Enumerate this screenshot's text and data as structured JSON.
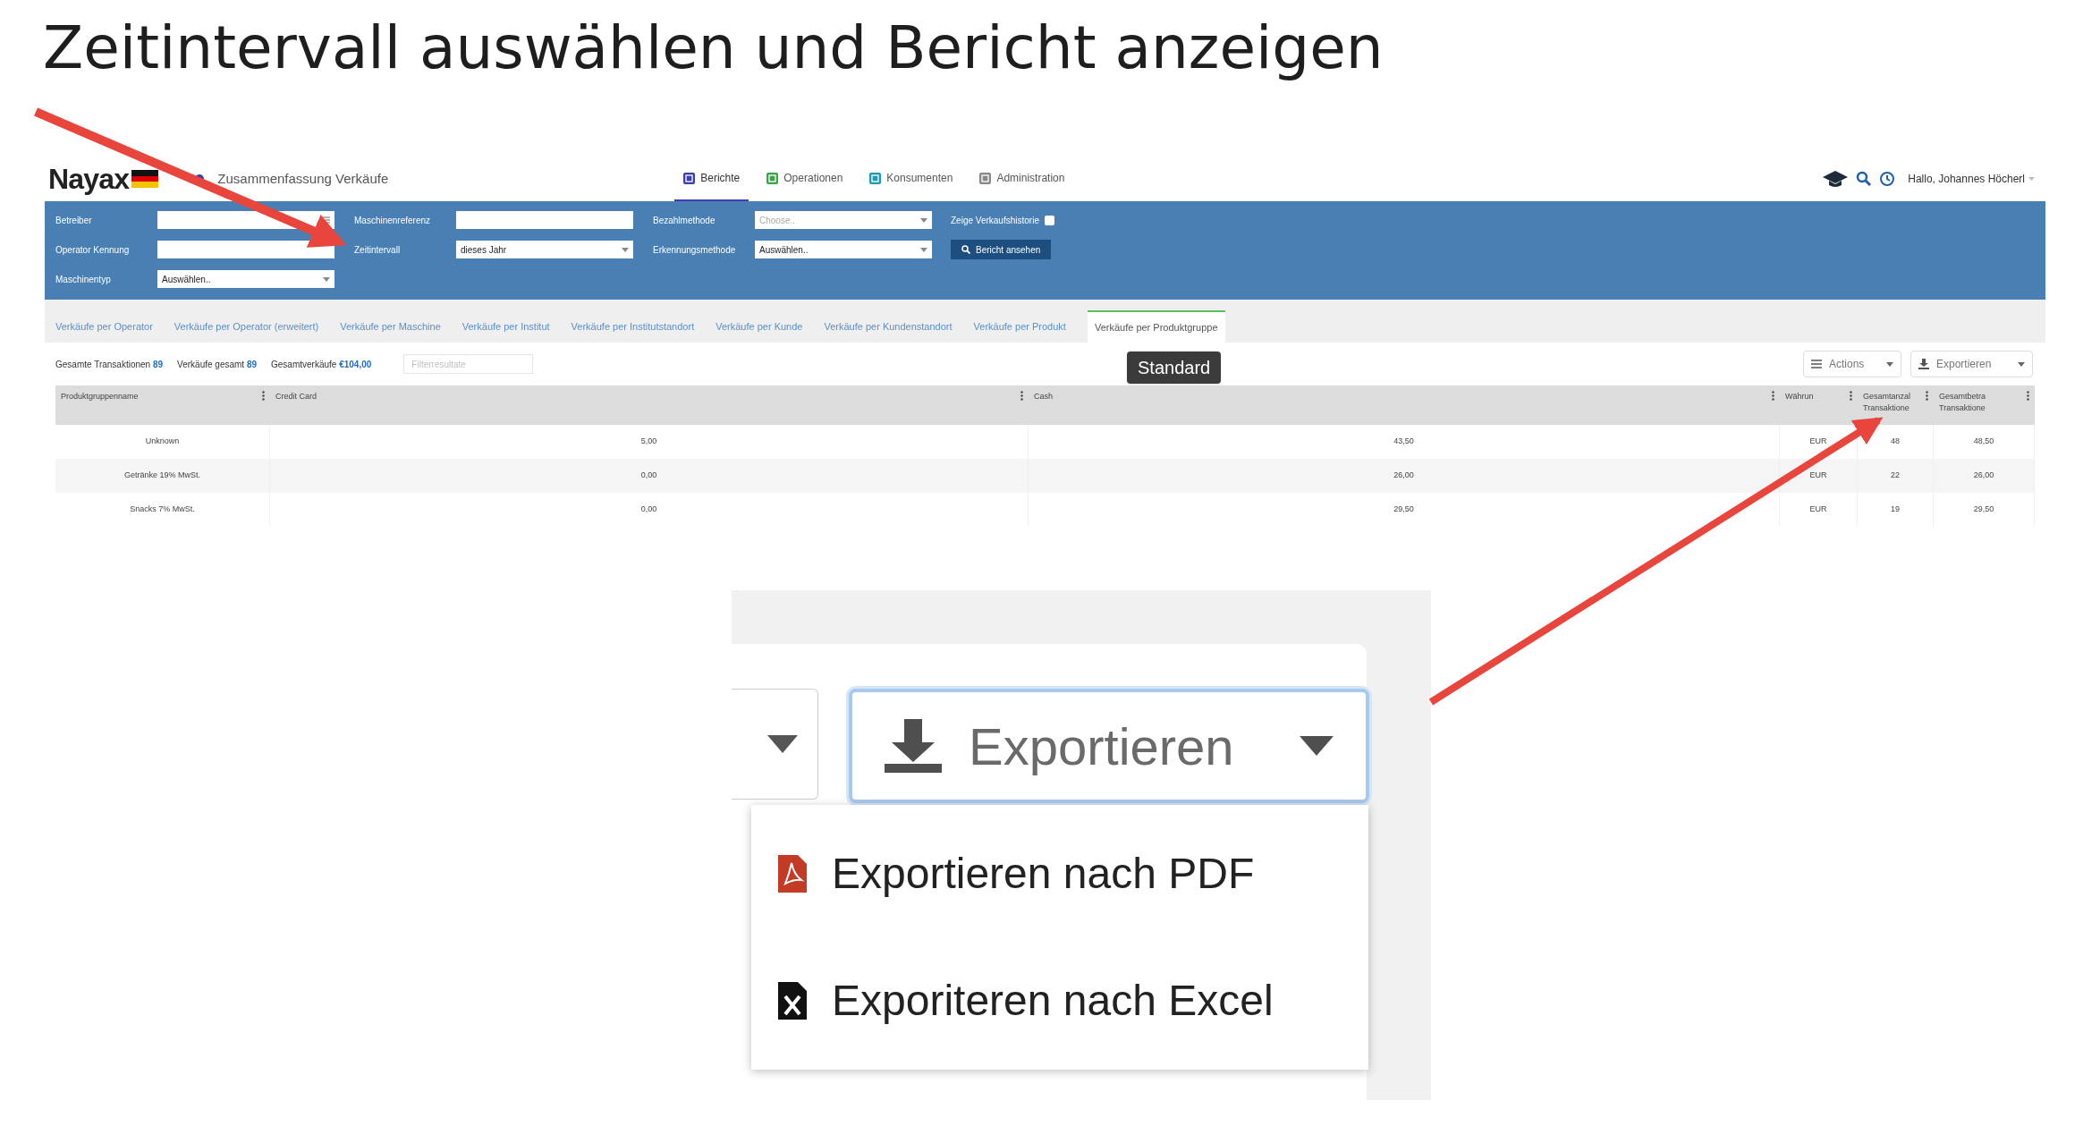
{
  "title": "Zeitintervall auswählen und Bericht anzeigen",
  "app": {
    "logo": "Nayax",
    "page_title": "Zusammenfassung Verkäufe",
    "nav": [
      {
        "label": "Berichte",
        "selected": true
      },
      {
        "label": "Operationen",
        "selected": false
      },
      {
        "label": "Konsumenten",
        "selected": false
      },
      {
        "label": "Administration",
        "selected": false
      }
    ],
    "user": "Hallo, Johannes Höcherl",
    "filters": [
      {
        "kind": "lookup",
        "label": "Betreiber"
      },
      {
        "kind": "text",
        "label": "Maschinenreferenz"
      },
      {
        "kind": "select",
        "label": "Bezahlmethode",
        "placeholder": "Choose.."
      },
      {
        "kind": "checkbox",
        "label": "Zeige Verkaufshistorie",
        "checked": false
      },
      {
        "kind": "text",
        "label": "Operator Kennung"
      },
      {
        "kind": "select",
        "label": "Zeitintervall",
        "value": "dieses Jahr"
      },
      {
        "kind": "select",
        "label": "Erkennungsmethode",
        "value": "Auswählen.."
      },
      {
        "kind": "button",
        "label": "Bericht ansehen"
      },
      {
        "kind": "select",
        "label": "Maschinentyp",
        "value": "Auswählen.."
      }
    ],
    "tabs": [
      {
        "label": "Verkäufe per Operator",
        "selected": false
      },
      {
        "label": "Verkäufe per Operator (erweitert)",
        "selected": false
      },
      {
        "label": "Verkäufe per Maschine",
        "selected": false
      },
      {
        "label": "Verkäufe per Institut",
        "selected": false
      },
      {
        "label": "Verkäufe per Institutstandort",
        "selected": false
      },
      {
        "label": "Verkäufe per Kunde",
        "selected": false
      },
      {
        "label": "Verkäufe per Kundenstandort",
        "selected": false
      },
      {
        "label": "Verkäufe per Produkt",
        "selected": false
      },
      {
        "label": "Verkäufe per Produktgruppe",
        "selected": true
      }
    ],
    "summary": [
      {
        "label": "Gesamte Transaktionen",
        "value": "89"
      },
      {
        "label": "Verkäufe gesamt",
        "value": "89"
      },
      {
        "label": "Gesamtverkäufe",
        "value": "€104,00"
      }
    ],
    "filter_placeholder": "Filterresultate",
    "tooltip": "Standard",
    "actions": "Actions",
    "export": "Exportieren",
    "table": {
      "columns": [
        "Produktgruppenname",
        "Credit Card",
        "Cash",
        "Währun",
        "Gesamtanzal Transaktione",
        "Gesamtbetra Transaktione"
      ],
      "rows": [
        [
          "Unknown",
          "5,00",
          "43,50",
          "EUR",
          "48",
          "48,50"
        ],
        [
          "Getränke 19% MwSt.",
          "0,00",
          "26,00",
          "EUR",
          "22",
          "26,00"
        ],
        [
          "Snacks 7% MwSt.",
          "0,00",
          "29,50",
          "EUR",
          "19",
          "29,50"
        ]
      ]
    }
  },
  "zoom": {
    "export": "Exportieren",
    "menu": [
      {
        "kind": "pdf",
        "label": "Exportieren nach PDF"
      },
      {
        "kind": "excel",
        "label": "Exporiteren nach Excel"
      }
    ]
  }
}
